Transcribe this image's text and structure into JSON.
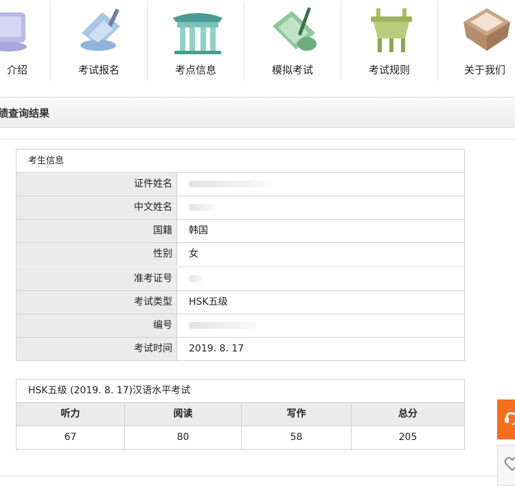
{
  "nav": {
    "items": [
      {
        "label": "介绍",
        "icon": "scroll-icon"
      },
      {
        "label": "考试报名",
        "icon": "scroll-brush-icon"
      },
      {
        "label": "考点信息",
        "icon": "pavilion-icon"
      },
      {
        "label": "模拟考试",
        "icon": "scroll-pen-icon"
      },
      {
        "label": "考试规则",
        "icon": "bronze-ding-icon"
      },
      {
        "label": "关于我们",
        "icon": "jade-seal-icon"
      }
    ]
  },
  "page_title": "成绩查询结果",
  "candidate": {
    "section_title": "考生信息",
    "rows": [
      {
        "label": "证件姓名",
        "value": ""
      },
      {
        "label": "中文姓名",
        "value": ""
      },
      {
        "label": "国籍",
        "value": "韩国"
      },
      {
        "label": "性别",
        "value": "女"
      },
      {
        "label": "准考证号",
        "value": ""
      },
      {
        "label": "考试类型",
        "value": "HSK五级"
      },
      {
        "label": "编号",
        "value": ""
      },
      {
        "label": "考试时间",
        "value": "2019. 8. 17"
      }
    ]
  },
  "scores": {
    "title": "HSK五级 (2019. 8. 17)汉语水平考试",
    "headers": [
      "听力",
      "阅读",
      "写作",
      "总分"
    ],
    "values": [
      "67",
      "80",
      "58",
      "205"
    ]
  },
  "colors": {
    "accent_orange": "#f46f1e",
    "label_bg": "#ebebeb",
    "border": "#d0d0d0"
  }
}
